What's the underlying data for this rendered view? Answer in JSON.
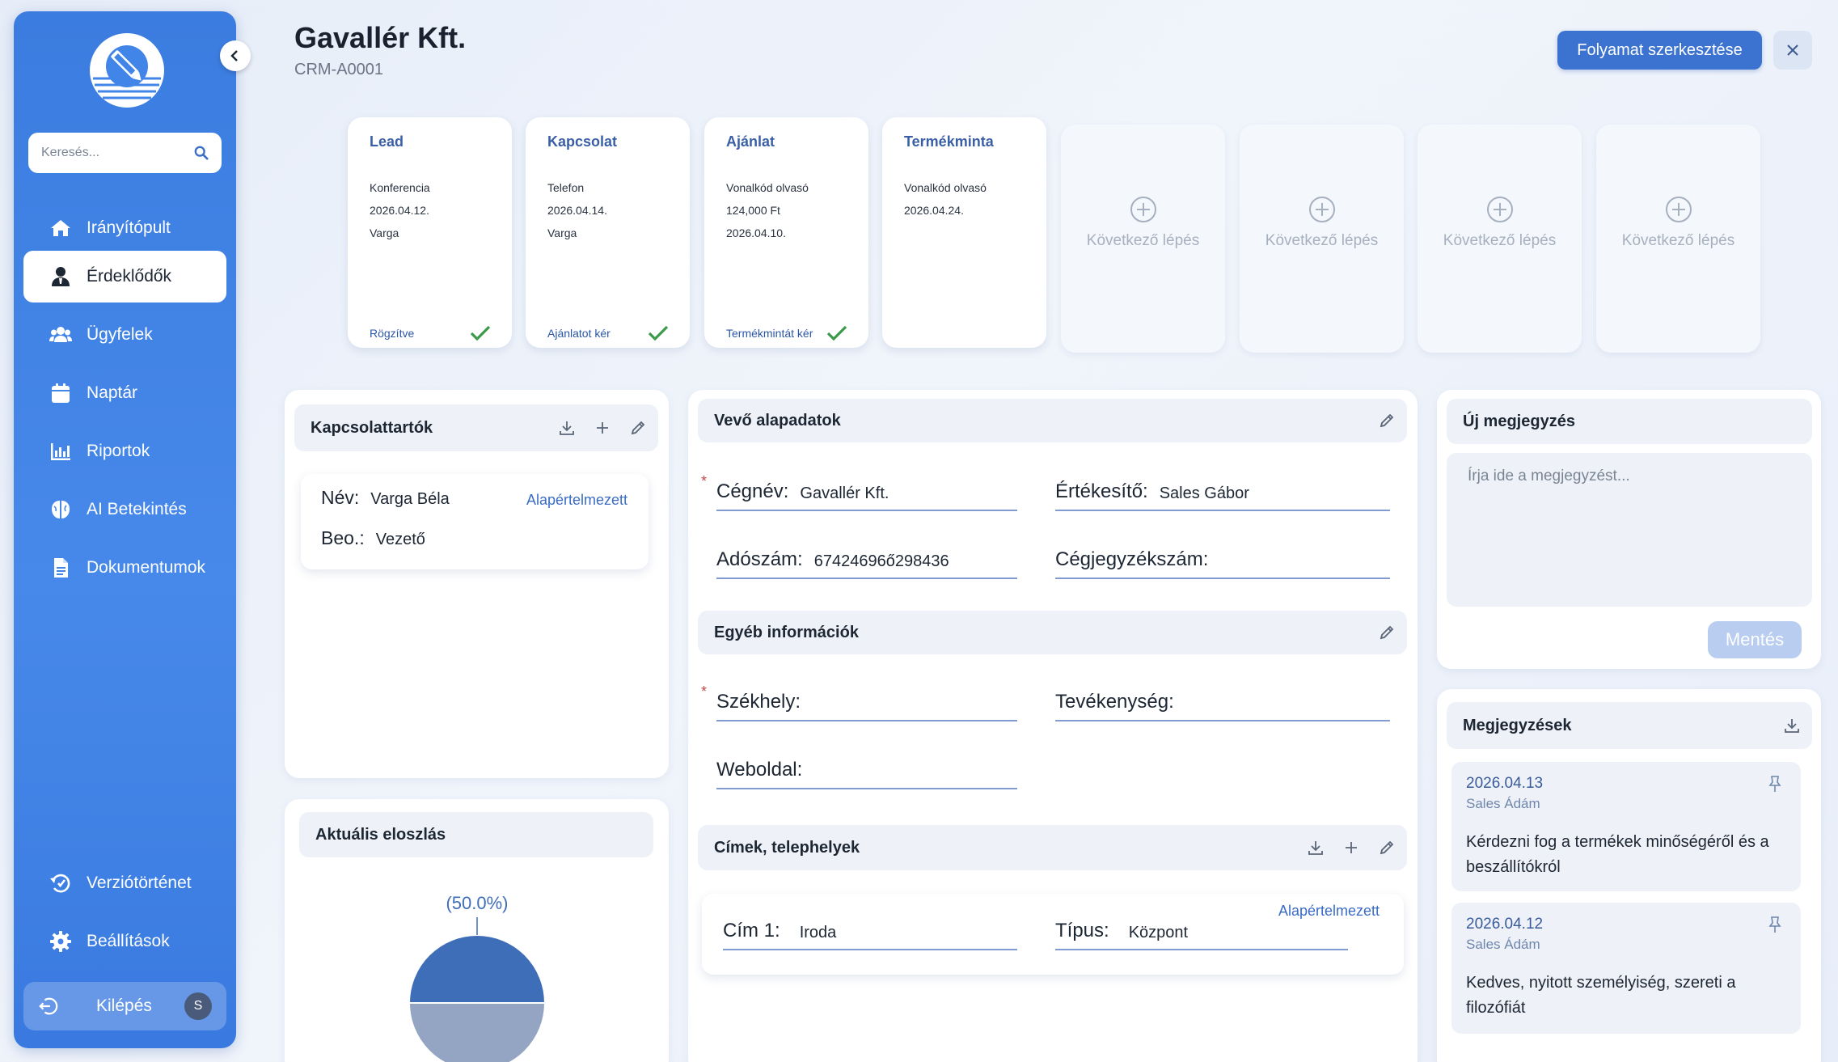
{
  "sidebar": {
    "search_placeholder": "Keresés...",
    "nav": [
      {
        "label": "Irányítópult"
      },
      {
        "label": "Érdeklődők"
      },
      {
        "label": "Ügyfelek"
      },
      {
        "label": "Naptár"
      },
      {
        "label": "Riportok"
      },
      {
        "label": "AI Betekintés"
      },
      {
        "label": "Dokumentumok"
      }
    ],
    "bottom_nav": [
      {
        "label": "Verziótörténet"
      },
      {
        "label": "Beállítások"
      }
    ],
    "logout_label": "Kilépés",
    "avatar_initial": "S"
  },
  "header": {
    "title": "Gavallér Kft.",
    "subtitle": "CRM-A0001",
    "edit_flow_label": "Folyamat szerkesztése"
  },
  "pipeline": {
    "steps": [
      {
        "title": "Lead",
        "lines": [
          "Konferencia",
          "2026.04.12.",
          "Varga"
        ],
        "status": "Rögzítve"
      },
      {
        "title": "Kapcsolat",
        "lines": [
          "Telefon",
          "2026.04.14.",
          "Varga"
        ],
        "status": "Ajánlatot kér"
      },
      {
        "title": "Ajánlat",
        "lines": [
          "Vonalkód olvasó",
          "124,000 Ft",
          "2026.04.10."
        ],
        "status": "Termékmintát kér"
      },
      {
        "title": "Termékminta",
        "lines": [
          "Vonalkód olvasó",
          "2026.04.24."
        ],
        "status": ""
      }
    ],
    "next_step_label": "Következő lépés"
  },
  "contacts": {
    "title": "Kapcsolattartók",
    "card": {
      "name_label": "Név:",
      "name": "Varga Béla",
      "role_label": "Beo.:",
      "role": "Vezető",
      "default_label": "Alapértelmezett"
    }
  },
  "distribution": {
    "title": "Aktuális eloszlás",
    "pie_label": "(50.0%)"
  },
  "chart_data": {
    "type": "pie",
    "values": [
      50,
      50
    ],
    "colors": [
      "#3f6eb8",
      "#93a5c2"
    ],
    "annotation": "(50.0%)"
  },
  "buyer": {
    "title": "Vevő alapadatok",
    "fields": {
      "company_label": "Cégnév:",
      "company": "Gavallér Kft.",
      "sales_label": "Értékesítő:",
      "sales": "Sales Gábor",
      "tax_label": "Adószám:",
      "tax": "67424696ő298436",
      "reg_label": "Cégjegyzékszám:",
      "reg": ""
    }
  },
  "other": {
    "title": "Egyéb információk",
    "fields": {
      "hq_label": "Székhely:",
      "hq": "",
      "activity_label": "Tevékenység:",
      "activity": "",
      "web_label": "Weboldal:",
      "web": ""
    }
  },
  "addresses": {
    "title": "Címek, telephelyek",
    "card": {
      "addr_label": "Cím 1:",
      "addr": "Iroda",
      "type_label": "Típus:",
      "type": "Központ",
      "default_label": "Alapértelmezett"
    }
  },
  "new_note": {
    "title": "Új megjegyzés",
    "placeholder": "Írja ide a megjegyzést...",
    "save_label": "Mentés"
  },
  "notes": {
    "title": "Megjegyzések",
    "items": [
      {
        "date": "2026.04.13",
        "author": "Sales Ádám",
        "text": "Kérdezni fog a termékek minőségéről és a beszállítókról"
      },
      {
        "date": "2026.04.12",
        "author": "Sales Ádám",
        "text": "Kedves, nyitott személyiség, szereti a filozófiát"
      }
    ]
  },
  "colors": {
    "accent": "#3c73d0",
    "sidebar": "#4285e8",
    "success": "#3a9a4a"
  }
}
